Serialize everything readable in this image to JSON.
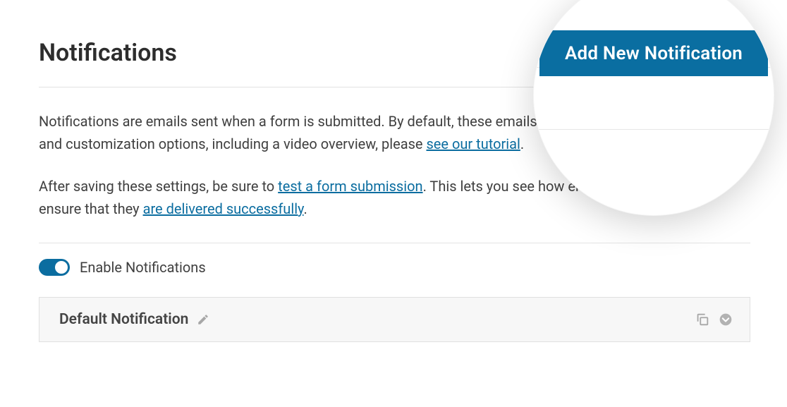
{
  "page": {
    "title": "Notifications"
  },
  "description": {
    "para1_prefix": "Notifications are emails sent when a form is submitted. By default, these emails include entry details. For setup and customization options, including a video overview, please ",
    "para1_link": "see our tutorial",
    "para1_suffix": ".",
    "para2_prefix": "After saving these settings, be sure to ",
    "para2_link1": "test a form submission",
    "para2_mid": ". This lets you see how emails will look, and to ensure that they ",
    "para2_link2": "are delivered successfully",
    "para2_suffix": "."
  },
  "toggle": {
    "enabled": true,
    "label": "Enable Notifications"
  },
  "notification_item": {
    "title": "Default Notification"
  },
  "add_button": {
    "label": "Add New Notification"
  },
  "colors": {
    "accent": "#0a6ea1",
    "link": "#0b6da0"
  }
}
